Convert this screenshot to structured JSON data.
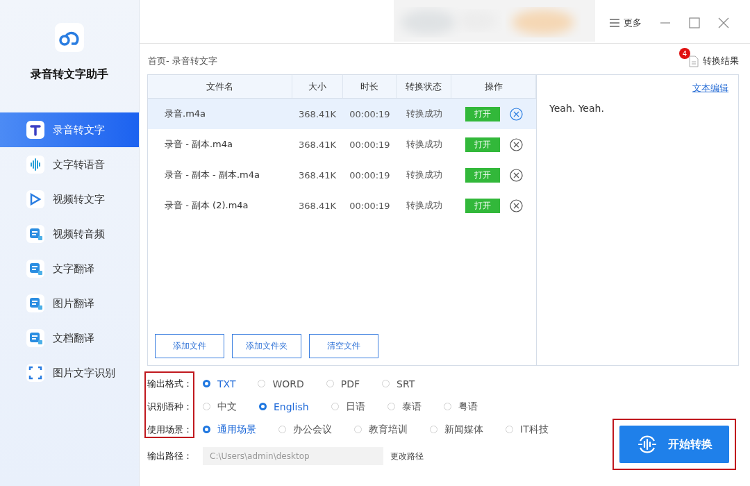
{
  "app": {
    "name": "录音转文字助手"
  },
  "sidebar": {
    "items": [
      {
        "label": "录音转文字",
        "selected": true
      },
      {
        "label": "文字转语音",
        "selected": false
      },
      {
        "label": "视频转文字",
        "selected": false
      },
      {
        "label": "视频转音频",
        "selected": false
      },
      {
        "label": "文字翻译",
        "selected": false
      },
      {
        "label": "图片翻译",
        "selected": false
      },
      {
        "label": "文档翻译",
        "selected": false
      },
      {
        "label": "图片文字识别",
        "selected": false
      }
    ]
  },
  "top_bar": {
    "more": "更多"
  },
  "breadcrumb": "首页- 录音转文字",
  "results": {
    "label": "转换结果",
    "badge": "4"
  },
  "table": {
    "columns": [
      "文件名",
      "大小",
      "时长",
      "转换状态",
      "操作"
    ],
    "rows": [
      {
        "name": "录音.m4a",
        "size": "368.41K",
        "duration": "00:00:19",
        "status": "转换成功",
        "action": "打开",
        "selected": true
      },
      {
        "name": "录音 - 副本.m4a",
        "size": "368.41K",
        "duration": "00:00:19",
        "status": "转换成功",
        "action": "打开",
        "selected": false
      },
      {
        "name": "录音 - 副本 - 副本.m4a",
        "size": "368.41K",
        "duration": "00:00:19",
        "status": "转换成功",
        "action": "打开",
        "selected": false
      },
      {
        "name": "录音 - 副本 (2).m4a",
        "size": "368.41K",
        "duration": "00:00:19",
        "status": "转换成功",
        "action": "打开",
        "selected": false
      }
    ]
  },
  "file_buttons": [
    "添加文件",
    "添加文件夹",
    "清空文件"
  ],
  "text_panel": {
    "link": "文本编辑",
    "content": "Yeah. Yeah."
  },
  "options": [
    {
      "label": "输出格式：",
      "choices": [
        {
          "label": "TXT",
          "selected": true
        },
        {
          "label": "WORD",
          "selected": false
        },
        {
          "label": "PDF",
          "selected": false
        },
        {
          "label": "SRT",
          "selected": false
        }
      ]
    },
    {
      "label": "识别语种：",
      "choices": [
        {
          "label": "中文",
          "selected": false
        },
        {
          "label": "English",
          "selected": true
        },
        {
          "label": "日语",
          "selected": false
        },
        {
          "label": "泰语",
          "selected": false
        },
        {
          "label": "粤语",
          "selected": false
        }
      ]
    },
    {
      "label": "使用场景：",
      "choices": [
        {
          "label": "通用场景",
          "selected": true
        },
        {
          "label": "办公会议",
          "selected": false
        },
        {
          "label": "教育培训",
          "selected": false
        },
        {
          "label": "新闻媒体",
          "selected": false
        },
        {
          "label": "IT科技",
          "selected": false
        }
      ]
    }
  ],
  "output_path": {
    "label": "输出路径：",
    "value": "C:\\Users\\admin\\desktop",
    "change": "更改路径"
  },
  "start_button": "开始转换"
}
